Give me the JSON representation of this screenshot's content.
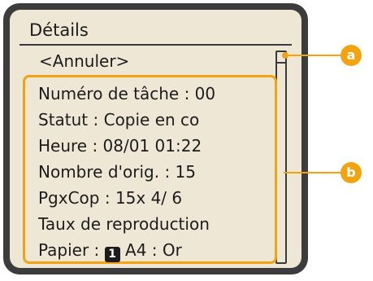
{
  "screen": {
    "title": "Détails",
    "cancel_label": "<Annuler>"
  },
  "details": [
    {
      "label": "Numéro de tâche : 00"
    },
    {
      "label": "Statut : Copie en co"
    },
    {
      "label": "Heure : 08/01 01:22"
    },
    {
      "label": "Nombre d'orig. : 15"
    },
    {
      "label": "PgxCop : 15x 4/ 6"
    },
    {
      "label": "Taux de reproduction"
    },
    {
      "label_before": "Papier : ",
      "tray_number": "1",
      "label_after": " A4 : Or"
    }
  ],
  "callouts": {
    "a": "a",
    "b": "b"
  },
  "colors": {
    "accent": "#f2a30f",
    "frame": "#3c3c3c",
    "screen": "#efe7d6",
    "text": "#1c1c1c"
  },
  "icons": {
    "tray": "paper-tray-number-icon"
  }
}
